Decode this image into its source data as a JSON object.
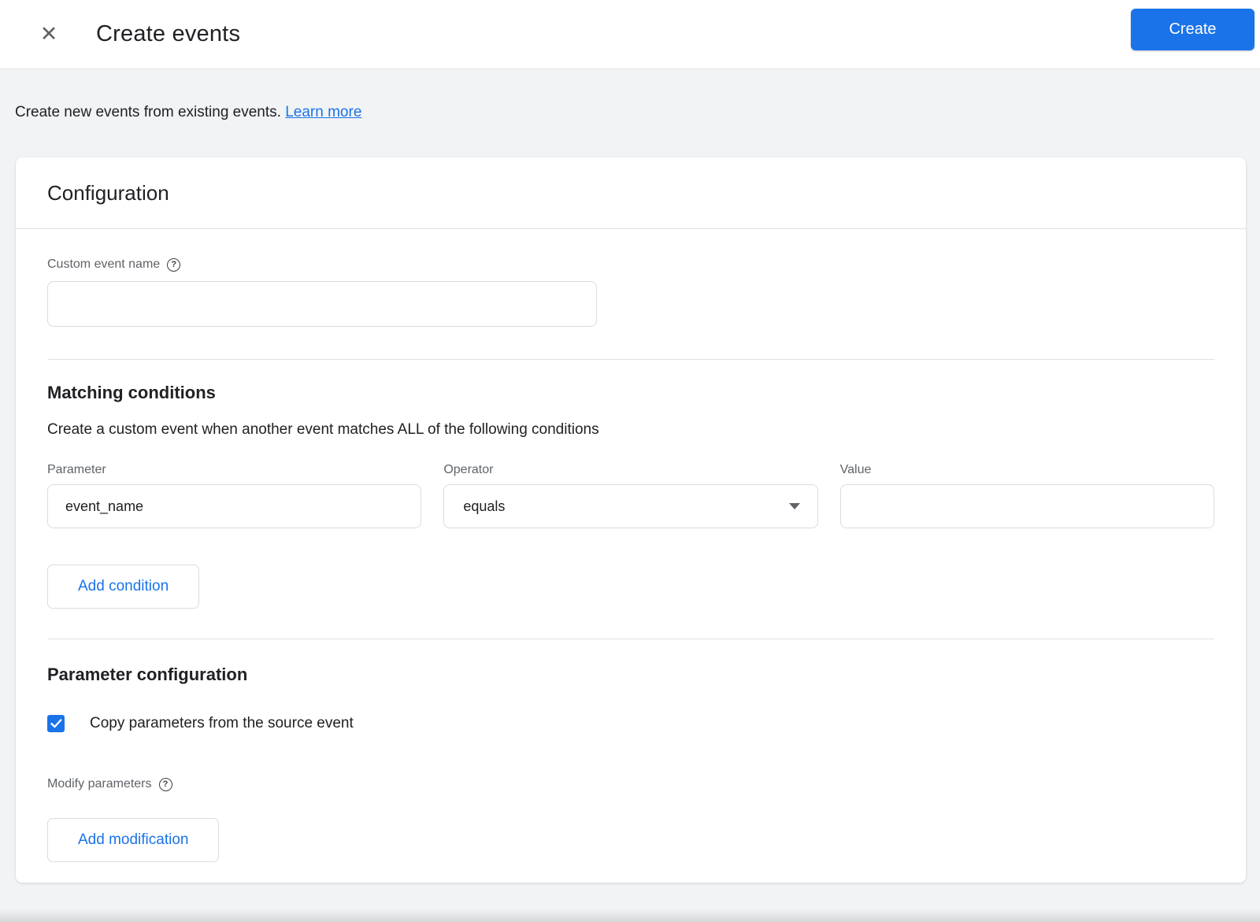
{
  "header": {
    "title": "Create events",
    "close_icon": "✕",
    "create_button_label": "Create"
  },
  "intro": {
    "text": "Create new events from existing events.",
    "link_label": "Learn more"
  },
  "card": {
    "title": "Configuration",
    "custom_event_name": {
      "label": "Custom event name",
      "help_icon": "?",
      "value": "",
      "placeholder": ""
    },
    "matching": {
      "title": "Matching conditions",
      "description": "Create a custom event when another event matches ALL of the following conditions",
      "fields": [
        {
          "label": "Parameter",
          "value": "event_name",
          "type": "text"
        },
        {
          "label": "Operator",
          "value": "equals",
          "type": "select"
        },
        {
          "label": "Value",
          "value": "",
          "type": "text"
        }
      ],
      "add_condition_label": "Add condition"
    },
    "parameter_config": {
      "title": "Parameter configuration",
      "copy_checkbox": {
        "label": "Copy parameters from the source event",
        "checked": true
      },
      "modify_label": "Modify parameters",
      "modify_help_icon": "?",
      "add_modification_label": "Add modification"
    }
  },
  "colors": {
    "accent_blue": "#1a73e8",
    "text_primary": "#202124",
    "text_muted": "#5f6368",
    "border": "#dadce0",
    "divider": "#e0e0e0",
    "page_background": "#f1f3f4"
  }
}
